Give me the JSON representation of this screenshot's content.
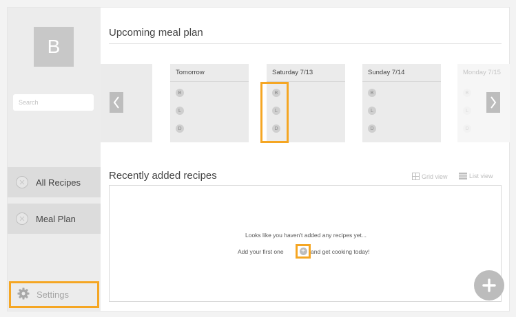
{
  "sidebar": {
    "avatar_letter": "B",
    "search_placeholder": "Search",
    "items": [
      {
        "label": "All Recipes",
        "icon": "close-circle-icon"
      },
      {
        "label": "Meal Plan",
        "icon": "close-circle-icon"
      }
    ],
    "settings": {
      "label": "Settings",
      "icon": "gear-icon"
    }
  },
  "meal_plan": {
    "title": "Upcoming meal plan",
    "days": [
      {
        "label": "Tomorrow",
        "meals": [
          "B",
          "L",
          "D"
        ]
      },
      {
        "label": "Saturday 7/13",
        "meals": [
          "B",
          "L",
          "D"
        ]
      },
      {
        "label": "Sunday 7/14",
        "meals": [
          "B",
          "L",
          "D"
        ]
      },
      {
        "label": "Monday 7/15",
        "meals": [
          "B",
          "L",
          "D"
        ]
      }
    ]
  },
  "recipes": {
    "title": "Recently added recipes",
    "grid_view_label": "Grid view",
    "list_view_label": "List view",
    "empty_line1": "Looks like you haven't added any recipes yet...",
    "empty_line2_start": "Add your first one",
    "empty_line2_end": "and get cooking today!"
  },
  "colors": {
    "highlight": "#f5a623",
    "sidebar_bg": "#ececec",
    "nav_item_bg": "#dcdcdc"
  }
}
